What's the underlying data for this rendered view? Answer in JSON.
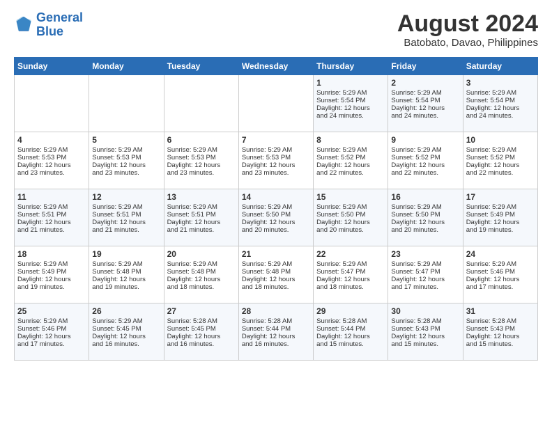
{
  "header": {
    "logo_line1": "General",
    "logo_line2": "Blue",
    "month_year": "August 2024",
    "location": "Batobato, Davao, Philippines"
  },
  "days_of_week": [
    "Sunday",
    "Monday",
    "Tuesday",
    "Wednesday",
    "Thursday",
    "Friday",
    "Saturday"
  ],
  "weeks": [
    [
      {
        "day": "",
        "info": ""
      },
      {
        "day": "",
        "info": ""
      },
      {
        "day": "",
        "info": ""
      },
      {
        "day": "",
        "info": ""
      },
      {
        "day": "1",
        "info": "Sunrise: 5:29 AM\nSunset: 5:54 PM\nDaylight: 12 hours\nand 24 minutes."
      },
      {
        "day": "2",
        "info": "Sunrise: 5:29 AM\nSunset: 5:54 PM\nDaylight: 12 hours\nand 24 minutes."
      },
      {
        "day": "3",
        "info": "Sunrise: 5:29 AM\nSunset: 5:54 PM\nDaylight: 12 hours\nand 24 minutes."
      }
    ],
    [
      {
        "day": "4",
        "info": "Sunrise: 5:29 AM\nSunset: 5:53 PM\nDaylight: 12 hours\nand 23 minutes."
      },
      {
        "day": "5",
        "info": "Sunrise: 5:29 AM\nSunset: 5:53 PM\nDaylight: 12 hours\nand 23 minutes."
      },
      {
        "day": "6",
        "info": "Sunrise: 5:29 AM\nSunset: 5:53 PM\nDaylight: 12 hours\nand 23 minutes."
      },
      {
        "day": "7",
        "info": "Sunrise: 5:29 AM\nSunset: 5:53 PM\nDaylight: 12 hours\nand 23 minutes."
      },
      {
        "day": "8",
        "info": "Sunrise: 5:29 AM\nSunset: 5:52 PM\nDaylight: 12 hours\nand 22 minutes."
      },
      {
        "day": "9",
        "info": "Sunrise: 5:29 AM\nSunset: 5:52 PM\nDaylight: 12 hours\nand 22 minutes."
      },
      {
        "day": "10",
        "info": "Sunrise: 5:29 AM\nSunset: 5:52 PM\nDaylight: 12 hours\nand 22 minutes."
      }
    ],
    [
      {
        "day": "11",
        "info": "Sunrise: 5:29 AM\nSunset: 5:51 PM\nDaylight: 12 hours\nand 21 minutes."
      },
      {
        "day": "12",
        "info": "Sunrise: 5:29 AM\nSunset: 5:51 PM\nDaylight: 12 hours\nand 21 minutes."
      },
      {
        "day": "13",
        "info": "Sunrise: 5:29 AM\nSunset: 5:51 PM\nDaylight: 12 hours\nand 21 minutes."
      },
      {
        "day": "14",
        "info": "Sunrise: 5:29 AM\nSunset: 5:50 PM\nDaylight: 12 hours\nand 20 minutes."
      },
      {
        "day": "15",
        "info": "Sunrise: 5:29 AM\nSunset: 5:50 PM\nDaylight: 12 hours\nand 20 minutes."
      },
      {
        "day": "16",
        "info": "Sunrise: 5:29 AM\nSunset: 5:50 PM\nDaylight: 12 hours\nand 20 minutes."
      },
      {
        "day": "17",
        "info": "Sunrise: 5:29 AM\nSunset: 5:49 PM\nDaylight: 12 hours\nand 19 minutes."
      }
    ],
    [
      {
        "day": "18",
        "info": "Sunrise: 5:29 AM\nSunset: 5:49 PM\nDaylight: 12 hours\nand 19 minutes."
      },
      {
        "day": "19",
        "info": "Sunrise: 5:29 AM\nSunset: 5:48 PM\nDaylight: 12 hours\nand 19 minutes."
      },
      {
        "day": "20",
        "info": "Sunrise: 5:29 AM\nSunset: 5:48 PM\nDaylight: 12 hours\nand 18 minutes."
      },
      {
        "day": "21",
        "info": "Sunrise: 5:29 AM\nSunset: 5:48 PM\nDaylight: 12 hours\nand 18 minutes."
      },
      {
        "day": "22",
        "info": "Sunrise: 5:29 AM\nSunset: 5:47 PM\nDaylight: 12 hours\nand 18 minutes."
      },
      {
        "day": "23",
        "info": "Sunrise: 5:29 AM\nSunset: 5:47 PM\nDaylight: 12 hours\nand 17 minutes."
      },
      {
        "day": "24",
        "info": "Sunrise: 5:29 AM\nSunset: 5:46 PM\nDaylight: 12 hours\nand 17 minutes."
      }
    ],
    [
      {
        "day": "25",
        "info": "Sunrise: 5:29 AM\nSunset: 5:46 PM\nDaylight: 12 hours\nand 17 minutes."
      },
      {
        "day": "26",
        "info": "Sunrise: 5:29 AM\nSunset: 5:45 PM\nDaylight: 12 hours\nand 16 minutes."
      },
      {
        "day": "27",
        "info": "Sunrise: 5:28 AM\nSunset: 5:45 PM\nDaylight: 12 hours\nand 16 minutes."
      },
      {
        "day": "28",
        "info": "Sunrise: 5:28 AM\nSunset: 5:44 PM\nDaylight: 12 hours\nand 16 minutes."
      },
      {
        "day": "29",
        "info": "Sunrise: 5:28 AM\nSunset: 5:44 PM\nDaylight: 12 hours\nand 15 minutes."
      },
      {
        "day": "30",
        "info": "Sunrise: 5:28 AM\nSunset: 5:43 PM\nDaylight: 12 hours\nand 15 minutes."
      },
      {
        "day": "31",
        "info": "Sunrise: 5:28 AM\nSunset: 5:43 PM\nDaylight: 12 hours\nand 15 minutes."
      }
    ]
  ]
}
